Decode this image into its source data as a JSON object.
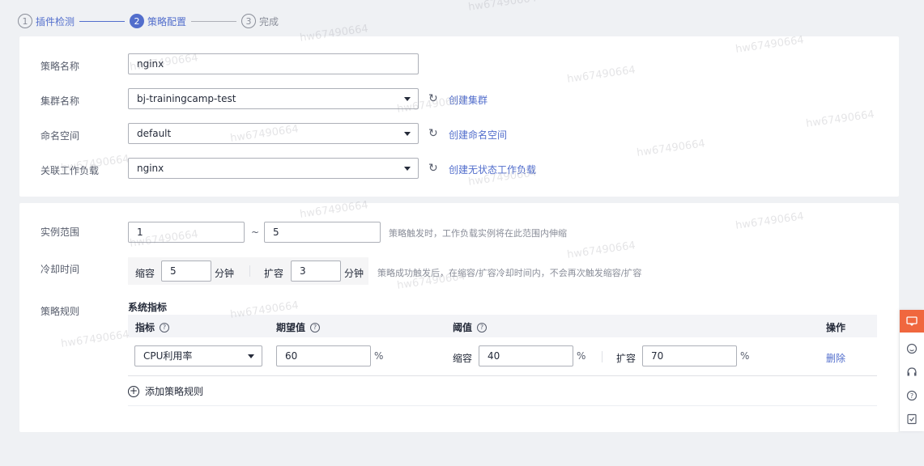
{
  "steps": [
    {
      "num": "1",
      "label": "插件检测"
    },
    {
      "num": "2",
      "label": "策略配置"
    },
    {
      "num": "3",
      "label": "完成"
    }
  ],
  "basic": {
    "policy_name_label": "策略名称",
    "policy_name_value": "nginx",
    "cluster_label": "集群名称",
    "cluster_value": "bj-trainingcamp-test",
    "create_cluster": "创建集群",
    "namespace_label": "命名空间",
    "namespace_value": "default",
    "create_namespace": "创建命名空间",
    "workload_label": "关联工作负载",
    "workload_value": "nginx",
    "create_workload": "创建无状态工作负载"
  },
  "scaling": {
    "range_label": "实例范围",
    "range_min": "1",
    "range_sep": "~",
    "range_max": "5",
    "range_hint": "策略触发时，工作负载实例将在此范围内伸缩",
    "cooldown_label": "冷却时间",
    "scale_in_label": "缩容",
    "scale_in_value": "5",
    "scale_in_unit": "分钟",
    "scale_out_label": "扩容",
    "scale_out_value": "3",
    "scale_out_unit": "分钟",
    "cooldown_hint": "策略成功触发后，在缩容/扩容冷却时间内，不会再次触发缩容/扩容",
    "rules_label": "策略规则",
    "section_title": "系统指标",
    "columns": {
      "metric": "指标",
      "expected": "期望值",
      "threshold": "阈值",
      "action": "操作"
    },
    "rule": {
      "metric": "CPU利用率",
      "expected": "60",
      "pct": "%",
      "scale_in_label": "缩容",
      "scale_in": "40",
      "scale_out_label": "扩容",
      "scale_out": "70",
      "delete": "删除"
    },
    "add_rule": "添加策略规则"
  },
  "watermark": "hw67490664",
  "colors": {
    "accent": "#526ecc",
    "float_primary": "#f0673e"
  }
}
